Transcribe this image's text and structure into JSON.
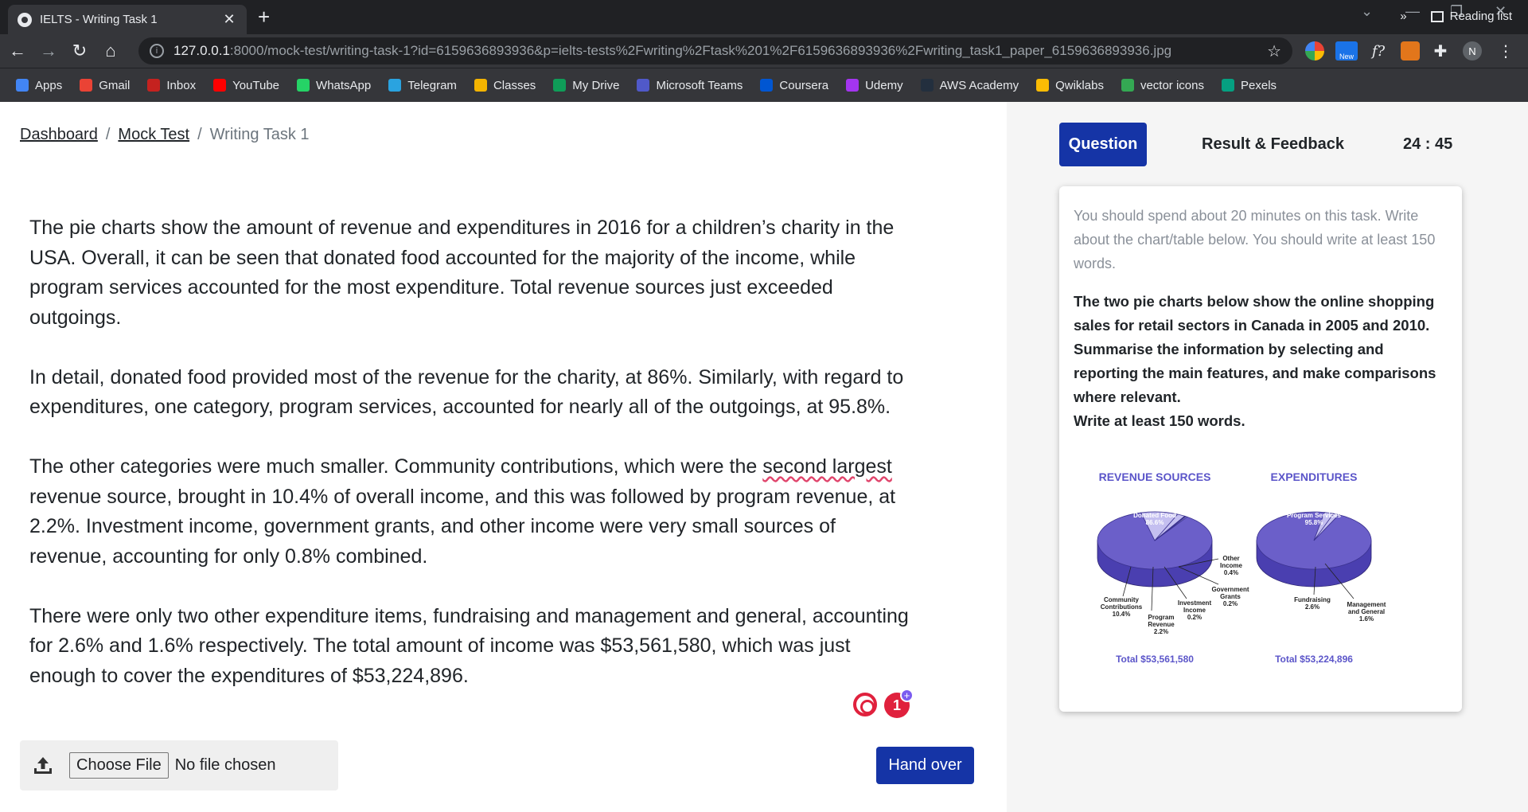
{
  "browser": {
    "tab_title": "IELTS - Writing Task 1",
    "url_host": "127.0.0.1",
    "url_rest": ":8000/mock-test/writing-task-1?id=6159636893936&p=ielts-tests%2Fwriting%2Ftask%201%2F6159636893936%2Fwriting_task1_paper_6159636893936.jpg",
    "ext_new_badge": "New",
    "ext_f_label": "f?",
    "profile_initial": "N",
    "bookmarks": [
      {
        "label": "Apps",
        "color": "#4285f4"
      },
      {
        "label": "Gmail",
        "color": "#ea4335"
      },
      {
        "label": "Inbox",
        "color": "#c5221f"
      },
      {
        "label": "YouTube",
        "color": "#ff0000"
      },
      {
        "label": "WhatsApp",
        "color": "#25d366"
      },
      {
        "label": "Telegram",
        "color": "#2aa3e0"
      },
      {
        "label": "Classes",
        "color": "#f4b400"
      },
      {
        "label": "My Drive",
        "color": "#0f9d58"
      },
      {
        "label": "Microsoft Teams",
        "color": "#5059c9"
      },
      {
        "label": "Coursera",
        "color": "#0056d2"
      },
      {
        "label": "Udemy",
        "color": "#a435f0"
      },
      {
        "label": "AWS Academy",
        "color": "#232f3e"
      },
      {
        "label": "Qwiklabs",
        "color": "#fbbc04"
      },
      {
        "label": "vector icons",
        "color": "#34a853"
      },
      {
        "label": "Pexels",
        "color": "#05a081"
      }
    ],
    "more_bookmarks": "»",
    "reading_list": "Reading list"
  },
  "breadcrumb": {
    "items": [
      "Dashboard",
      "Mock Test"
    ],
    "current": "Writing Task 1",
    "separator": "/"
  },
  "essay": {
    "p1": "The pie charts show the amount of revenue and expenditures in 2016 for a children’s charity in the USA. Overall, it can be seen that donated food accounted for the majority of the income, while program services accounted for the most expenditure. Total revenue sources just exceeded outgoings.",
    "p2": "In detail, donated food provided most of the revenue for the charity, at 86%. Similarly, with regard to expenditures, one category, program services, accounted for nearly all of the outgoings, at 95.8%.",
    "p3_a": "The other categories were much smaller. Community contributions, which were the ",
    "p3_flag": "second largest",
    "p3_b": " revenue source, brought in 10.4% of overall income, and this was followed by program revenue, at 2.2%. Investment income, government grants, and other income were very small sources of revenue, accounting for only 0.8% combined.",
    "p4": "There were only two other expenditure items, fundraising and management and general, accounting for 2.6% and 1.6% respectively. The total amount of income was $53,561,580, which was just enough to cover the expenditures of $53,224,896."
  },
  "grammar": {
    "count": "1",
    "plus": "+"
  },
  "upload": {
    "button": "Choose File",
    "status": "No file chosen"
  },
  "actions": {
    "hand_over": "Hand over"
  },
  "panel": {
    "tab_question": "Question",
    "tab_result": "Result & Feedback",
    "timer": "24 : 45",
    "instructions": "You should spend about 20 minutes on this task. Write about the chart/table below. You should write at least 150 words.",
    "prompt": "The two pie charts below show the online shopping sales for retail sectors in Canada in 2005 and 2010. Summarise the information by selecting and reporting the main features, and make comparisons where relevant.",
    "prompt_last": "Write at least 150 words."
  },
  "chart_data": [
    {
      "type": "pie",
      "title": "REVENUE SOURCES",
      "categories": [
        "Donated Food",
        "Community Contributions",
        "Program Revenue",
        "Investment Income",
        "Government Grants",
        "Other Income"
      ],
      "values": [
        86.6,
        10.4,
        2.2,
        0.2,
        0.2,
        0.4
      ],
      "labels": [
        "Donated Food\n86.6%",
        "Community\nContributions\n10.4%",
        "Program\nRevenue\n2.2%",
        "Investment\nIncome\n0.2%",
        "Government\nGrants\n0.2%",
        "Other\nIncome\n0.4%"
      ],
      "total": "Total $53,561,580"
    },
    {
      "type": "pie",
      "title": "EXPENDITURES",
      "categories": [
        "Program Services",
        "Fundraising",
        "Management and General"
      ],
      "values": [
        95.8,
        2.6,
        1.6
      ],
      "labels": [
        "Program Services\n95.8%",
        "Fundraising\n2.6%",
        "Management\nand General\n1.6%"
      ],
      "total": "Total $53,224,896"
    }
  ],
  "colors": {
    "primary": "#1534a6",
    "pie_main": "#6b5fc9",
    "pie_light": "#c4bff0",
    "chart_title": "#5b55c9",
    "grammar": "#e0213d"
  }
}
